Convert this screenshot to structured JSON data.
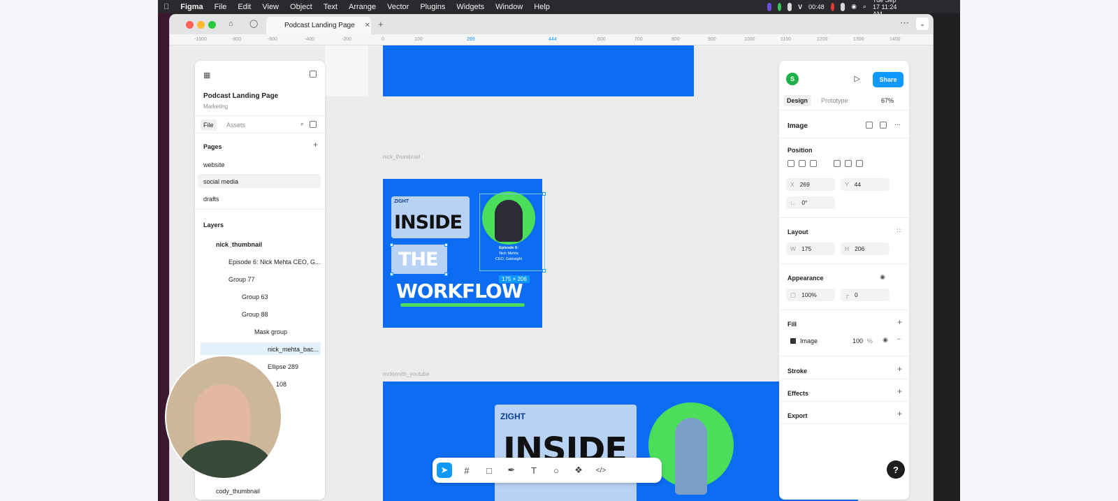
{
  "menubar": {
    "app": "Figma",
    "items": [
      "File",
      "Edit",
      "View",
      "Object",
      "Text",
      "Arrange",
      "Vector",
      "Plugins",
      "Widgets",
      "Window",
      "Help"
    ],
    "timer": "00:48",
    "datetime": "Tue Sep 17  11:24 AM"
  },
  "tab": {
    "title": "Podcast Landing Page"
  },
  "ruler": {
    "labels": [
      "-1000",
      "-800",
      "-600",
      "-400",
      "-200",
      "0",
      "100",
      "269",
      "444",
      "600",
      "700",
      "800",
      "900",
      "1000",
      "1100",
      "1200",
      "1300",
      "1400"
    ]
  },
  "file": {
    "name": "Podcast Landing Page",
    "team": "Marketing"
  },
  "left_tabs": {
    "file": "File",
    "assets": "Assets"
  },
  "pages": {
    "title": "Pages",
    "items": [
      "website",
      "social media",
      "drafts"
    ]
  },
  "layers": {
    "title": "Layers",
    "items": [
      {
        "label": "nick_thumbnail"
      },
      {
        "label": "Episode 6: Nick Mehta CEO, G..."
      },
      {
        "label": "Group 77"
      },
      {
        "label": "Group 63"
      },
      {
        "label": "Group 88"
      },
      {
        "label": "Mask group"
      },
      {
        "label": "nick_mehta_bac..."
      },
      {
        "label": "Ellipse 289"
      },
      {
        "label": "108"
      }
    ],
    "bottom": "cody_thumbnail"
  },
  "canvas": {
    "frame1_label": "nick_thumbnail",
    "frame2_label": "mckinnith_youtube",
    "brand": "ZIGHT",
    "word1": "INSIDE",
    "word2": "THE",
    "word3": "WORKFLOW",
    "episode": "Episode 6:",
    "guest": "Nick Mehta",
    "role": "CEO, Gainsight",
    "size_badge": "175 × 206",
    "brand2": "ZIGHT",
    "word1b": "INSIDE"
  },
  "right": {
    "avatar": "S",
    "share": "Share",
    "tab_design": "Design",
    "tab_prototype": "Prototype",
    "zoom": "67%",
    "selection": "Image",
    "position": {
      "title": "Position",
      "x_label": "X",
      "x": "269",
      "y_label": "Y",
      "y": "44",
      "rot": "0°"
    },
    "layout": {
      "title": "Layout",
      "w_label": "W",
      "w": "175",
      "h_label": "H",
      "h": "206"
    },
    "appearance": {
      "title": "Appearance",
      "opacity": "100%",
      "radius": "0"
    },
    "fill": {
      "title": "Fill",
      "type": "Image",
      "value": "100",
      "unit": "%"
    },
    "stroke": "Stroke",
    "effects": "Effects",
    "export": "Export"
  },
  "help": "?",
  "colors": {
    "accent": "#0d99ff",
    "canvas_blue": "#0c6cf2",
    "green": "#4ade5b"
  }
}
